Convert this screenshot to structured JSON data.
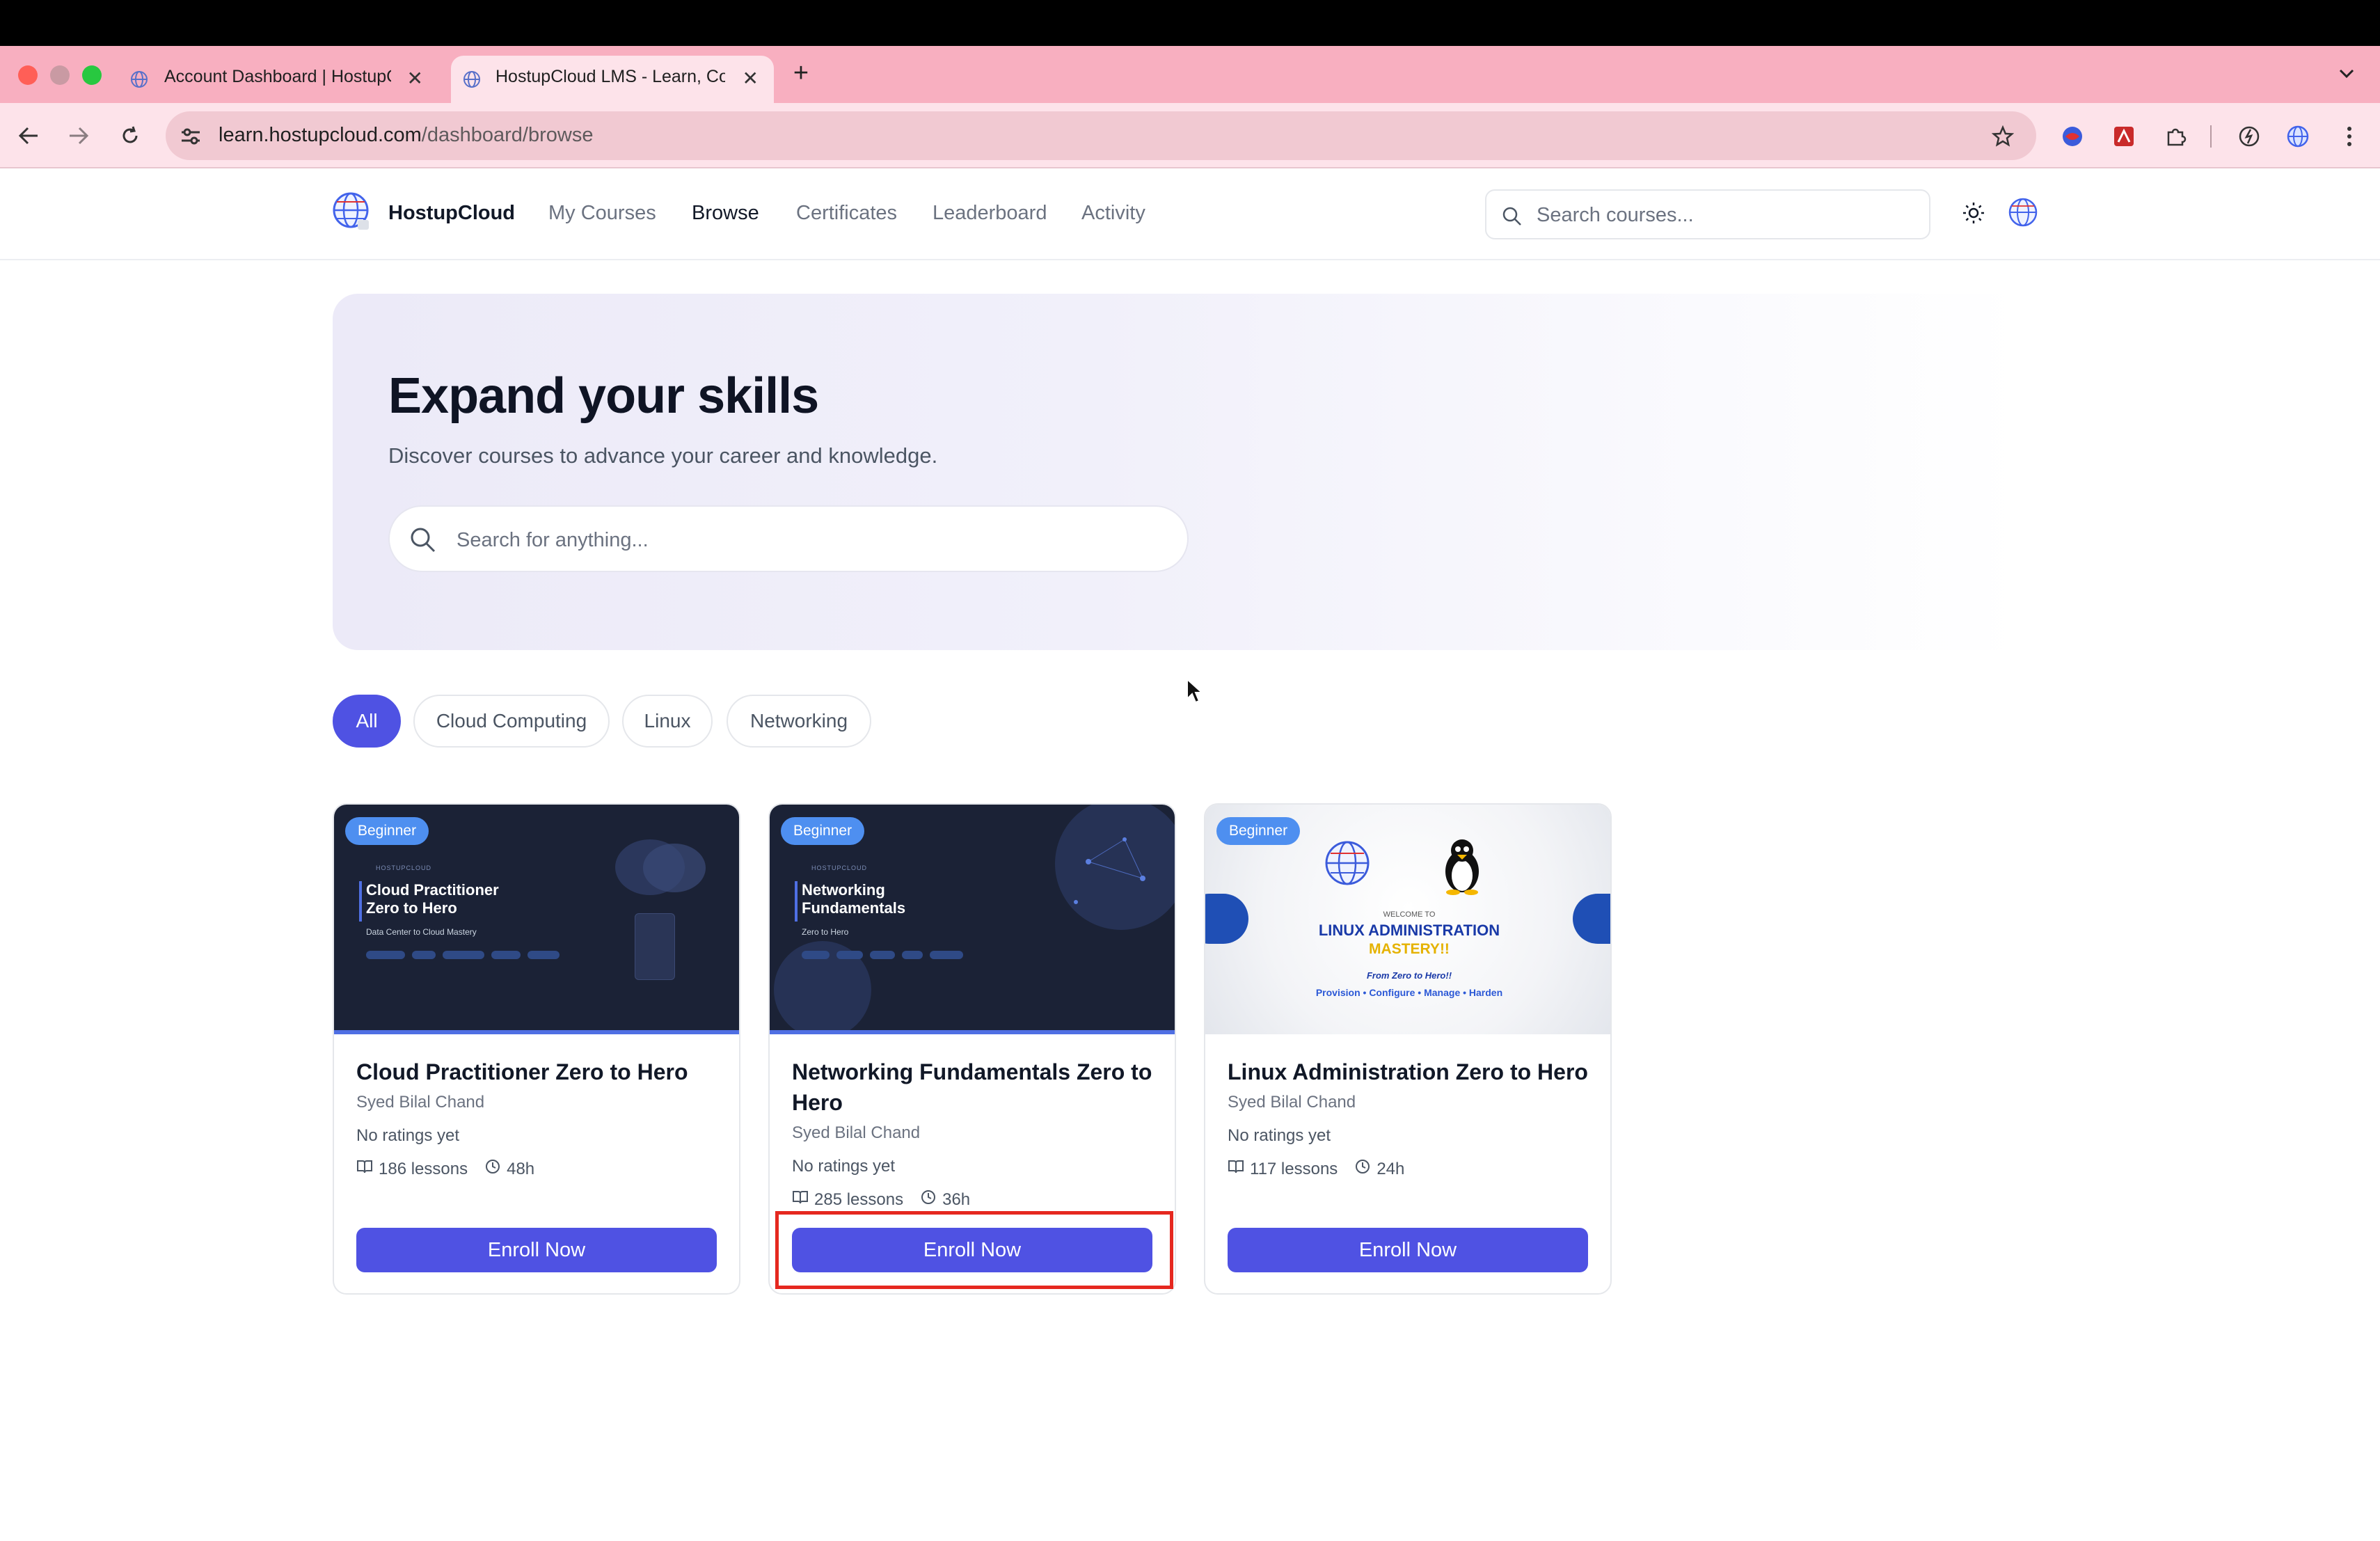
{
  "browser": {
    "tabs": [
      {
        "title": "Account Dashboard | HostupC"
      },
      {
        "title": "HostupCloud LMS - Learn, Co"
      }
    ],
    "url_domain": "learn.hostupcloud.com",
    "url_path": "/dashboard/browse"
  },
  "nav": {
    "brand": "HostupCloud",
    "links": [
      "My Courses",
      "Browse",
      "Certificates",
      "Leaderboard",
      "Activity"
    ],
    "active": "Browse",
    "search_placeholder": "Search courses..."
  },
  "hero": {
    "title": "Expand your skills",
    "subtitle": "Discover courses to advance your career and knowledge.",
    "search_placeholder": "Search for anything..."
  },
  "categories": {
    "items": [
      "All",
      "Cloud Computing",
      "Linux",
      "Networking"
    ],
    "selected": "All"
  },
  "courses": [
    {
      "level": "Beginner",
      "title": "Cloud Practitioner Zero to Hero",
      "author": "Syed Bilal Chand",
      "rating": "No ratings yet",
      "lessons": "186 lessons",
      "duration": "48h",
      "button": "Enroll Now",
      "thumb": {
        "brand": "HOSTUPCLOUD",
        "line1": "Cloud Practitioner",
        "line2": "Zero to Hero",
        "tagline": "Data Center to Cloud Mastery"
      }
    },
    {
      "level": "Beginner",
      "title": "Networking Fundamentals Zero to Hero",
      "author": "Syed Bilal Chand",
      "rating": "No ratings yet",
      "lessons": "285 lessons",
      "duration": "36h",
      "button": "Enroll Now",
      "thumb": {
        "brand": "HOSTUPCLOUD",
        "line1": "Networking",
        "line2": "Fundamentals",
        "tagline": "Zero to Hero"
      }
    },
    {
      "level": "Beginner",
      "title": "Linux Administration Zero to Hero",
      "author": "Syed Bilal Chand",
      "rating": "No ratings yet",
      "lessons": "117 lessons",
      "duration": "24h",
      "button": "Enroll Now",
      "thumb": {
        "welcome": "WELCOME TO",
        "line1": "LINUX ADMINISTRATION",
        "line2": "MASTERY!!",
        "tagline": "From Zero to Hero!!",
        "pillars": "Provision • Configure • Manage • Harden"
      }
    }
  ],
  "colors": {
    "accent": "#4f52e3",
    "badge": "#4e8ff0",
    "tabstrip": "#f8afc0",
    "highlight": "#e5281f"
  }
}
